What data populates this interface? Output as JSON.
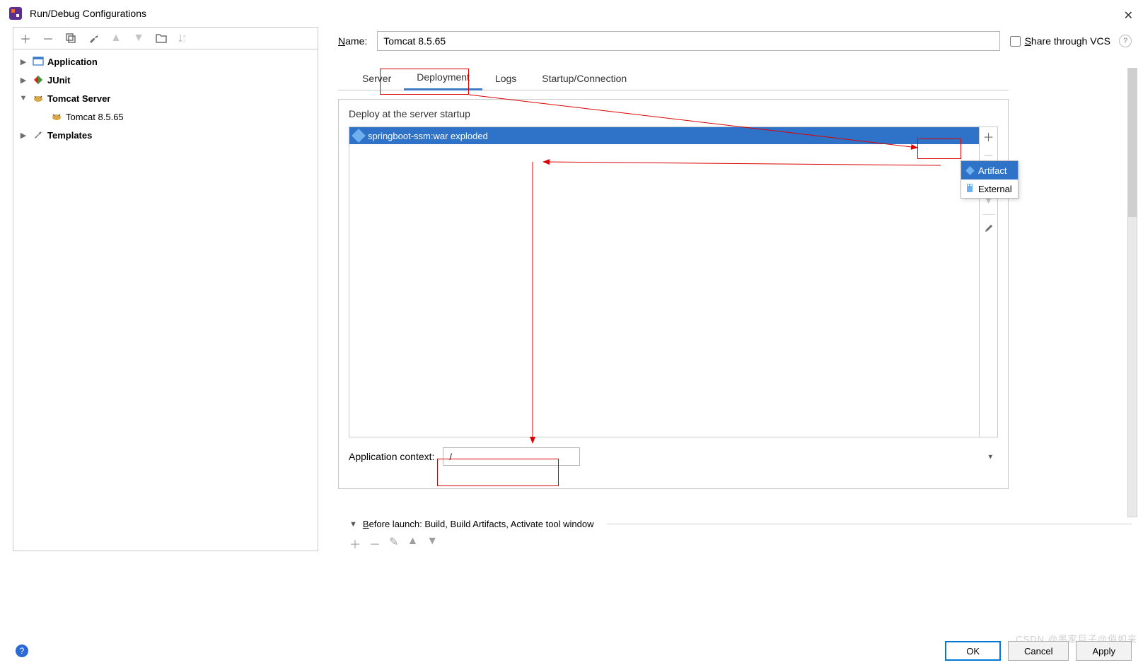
{
  "window": {
    "title": "Run/Debug Configurations"
  },
  "tree": {
    "items": [
      {
        "label": "Application",
        "bold": true,
        "chevron": "right",
        "icon": "app"
      },
      {
        "label": "JUnit",
        "bold": true,
        "chevron": "right",
        "icon": "junit"
      },
      {
        "label": "Tomcat Server",
        "bold": true,
        "chevron": "down",
        "icon": "tomcat"
      },
      {
        "label": "Tomcat 8.5.65",
        "bold": false,
        "chevron": "",
        "icon": "tomcat",
        "indent": true
      },
      {
        "label": "Templates",
        "bold": true,
        "chevron": "right",
        "icon": "wrench"
      }
    ]
  },
  "form": {
    "name_label_prefix": "N",
    "name_label_rest": "ame:",
    "name_value": "Tomcat 8.5.65",
    "share_prefix": "S",
    "share_rest": "hare through VCS"
  },
  "tabs": {
    "items": [
      {
        "label": "Server",
        "active": false
      },
      {
        "label": "Deployment",
        "active": true
      },
      {
        "label": "Logs",
        "active": false
      },
      {
        "label": "Startup/Connection",
        "active": false
      }
    ]
  },
  "deployment": {
    "section_label": "Deploy at the server startup",
    "items": [
      {
        "label": "springboot-ssm:war exploded"
      }
    ],
    "context_label": "Application context:",
    "context_value": "/"
  },
  "before_launch": {
    "prefix": "B",
    "text": "efore launch: Build, Build Artifacts, Activate tool window"
  },
  "popup": {
    "items": [
      {
        "label": "Artifact",
        "selected": true
      },
      {
        "label": "External",
        "selected": false
      }
    ]
  },
  "footer": {
    "ok": "OK",
    "cancel": "Cancel",
    "apply": "Apply"
  },
  "watermark": "CSDN @墨家巨子@俏如来"
}
